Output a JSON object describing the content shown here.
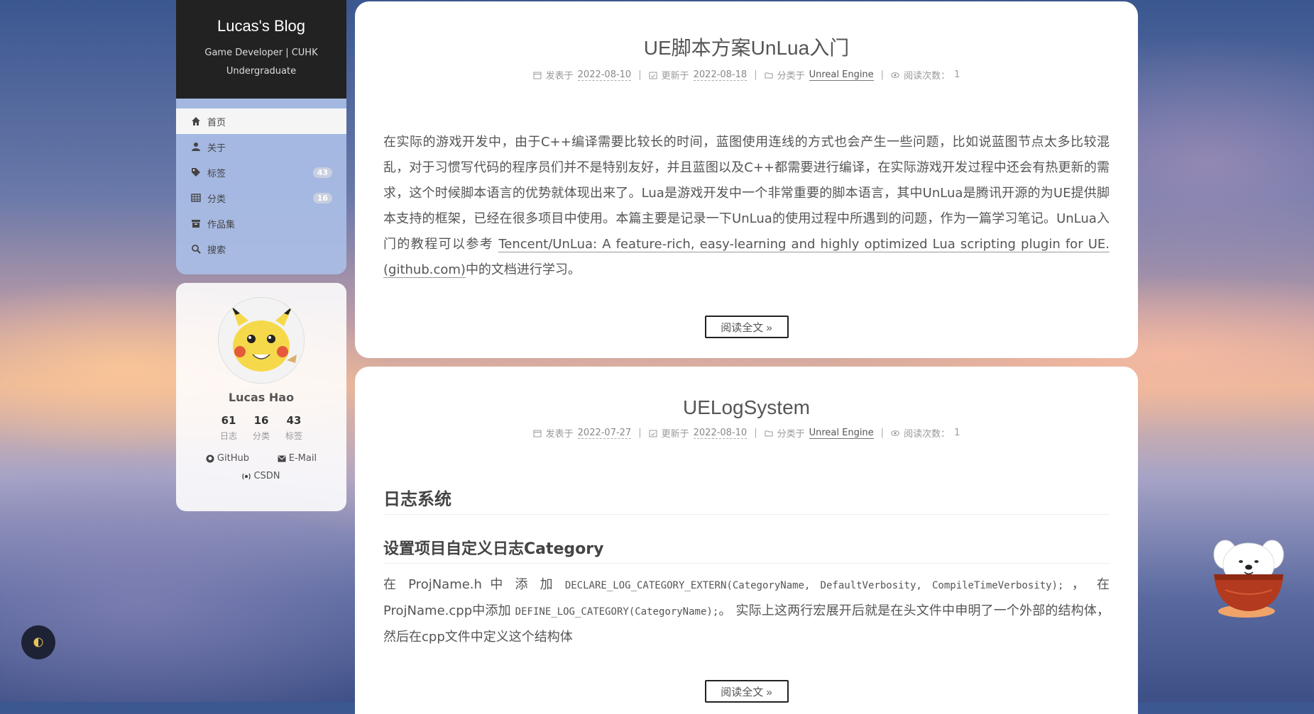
{
  "site": {
    "title": "Lucas's Blog",
    "subtitle": "Game Developer | CUHK Undergraduate"
  },
  "menu": {
    "items": [
      {
        "label": "首页",
        "icon": "home-icon"
      },
      {
        "label": "关于",
        "icon": "user-icon"
      },
      {
        "label": "标签",
        "icon": "tags-icon",
        "badge": "43"
      },
      {
        "label": "分类",
        "icon": "grid-icon",
        "badge": "16"
      },
      {
        "label": "作品集",
        "icon": "archive-icon"
      },
      {
        "label": "搜索",
        "icon": "search-icon"
      }
    ]
  },
  "author": {
    "name": "Lucas Hao",
    "stats": [
      {
        "count": "61",
        "label": "日志"
      },
      {
        "count": "16",
        "label": "分类"
      },
      {
        "count": "43",
        "label": "标签"
      }
    ],
    "links": {
      "github": "GitHub",
      "email": "E-Mail",
      "csdn": "CSDN"
    }
  },
  "posts": [
    {
      "title": "UE脚本方案UnLua入门",
      "published_label": "发表于",
      "published": "2022-08-10",
      "updated_label": "更新于",
      "updated": "2022-08-18",
      "category_label": "分类于",
      "category": "Unreal Engine",
      "views_label": "阅读次数：",
      "views": "1",
      "body_text": "在实际的游戏开发中，由于C++编译需要比较长的时间，蓝图使用连线的方式也会产生一些问题，比如说蓝图节点太多比较混乱，对于习惯写代码的程序员们并不是特别友好，并且蓝图以及C++都需要进行编译，在实际游戏开发过程中还会有热更新的需求，这个时候脚本语言的优势就体现出来了。Lua是游戏开发中一个非常重要的脚本语言，其中UnLua是腾讯开源的为UE提供脚本支持的框架，已经在很多项目中使用。本篇主要是记录一下UnLua的使用过程中所遇到的问题，作为一篇学习笔记。UnLua入门的教程可以参考 ",
      "body_link": "Tencent/UnLua: A feature-rich, easy-learning and highly optimized Lua scripting plugin for UE. (github.com)",
      "body_tail": "中的文档进行学习。",
      "read_more": "阅读全文 »"
    },
    {
      "title": "UELogSystem",
      "published_label": "发表于",
      "published": "2022-07-27",
      "updated_label": "更新于",
      "updated": "2022-08-10",
      "category_label": "分类于",
      "category": "Unreal Engine",
      "views_label": "阅读次数：",
      "views": "1",
      "h2": "日志系统",
      "h3": "设置项目自定义日志Category",
      "p1": "在 ProjName.h 中 添 加 ",
      "code1": "DECLARE_LOG_CATEGORY_EXTERN(CategoryName, DefaultVerbosity, CompileTimeVerbosity);",
      "p2": " ， 在 ProjName.cpp中添加 ",
      "code2": "DEFINE_LOG_CATEGORY(CategoryName);",
      "p3": "。 实际上这两行宏展开后就是在头文件中申明了一个外部的结构体，然后在cpp文件中定义这个结构体",
      "read_more": "阅读全文 »"
    }
  ],
  "colors": {
    "header_bg": "#222222",
    "menu_bg": "#AABEE6",
    "card_bg": "#FFFFFF"
  }
}
